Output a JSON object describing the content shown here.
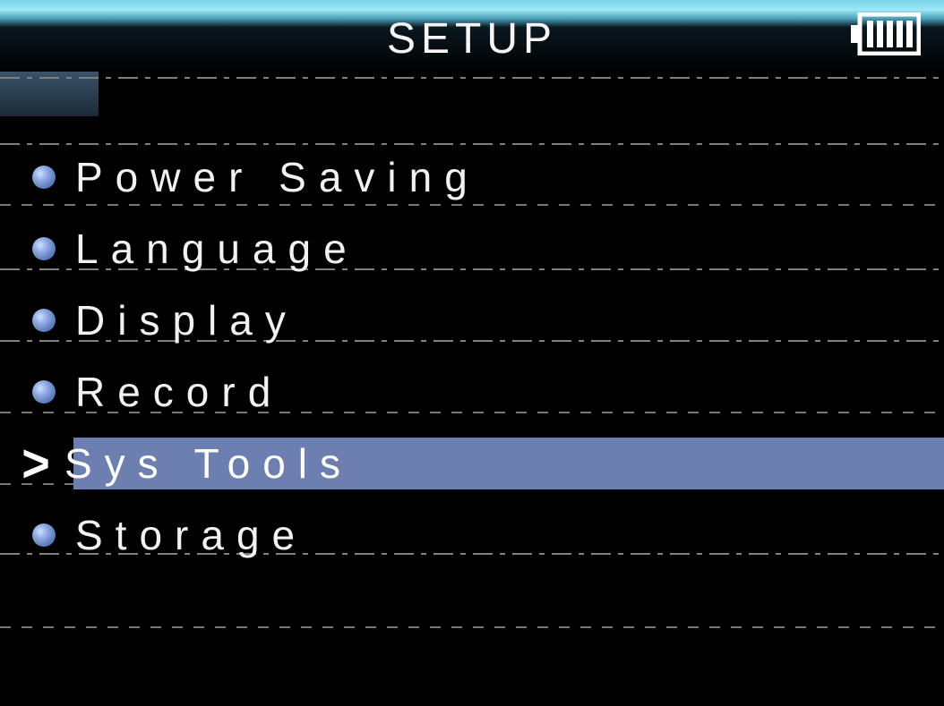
{
  "header": {
    "title": "SETUP"
  },
  "menu": {
    "items": [
      {
        "label": "Power Saving",
        "selected": false
      },
      {
        "label": "Language",
        "selected": false
      },
      {
        "label": "Display",
        "selected": false
      },
      {
        "label": "Record",
        "selected": false
      },
      {
        "label": "Sys Tools",
        "selected": true
      },
      {
        "label": "Storage",
        "selected": false
      }
    ]
  },
  "icons": {
    "battery": "battery-icon",
    "cursor_glyph": ">"
  }
}
